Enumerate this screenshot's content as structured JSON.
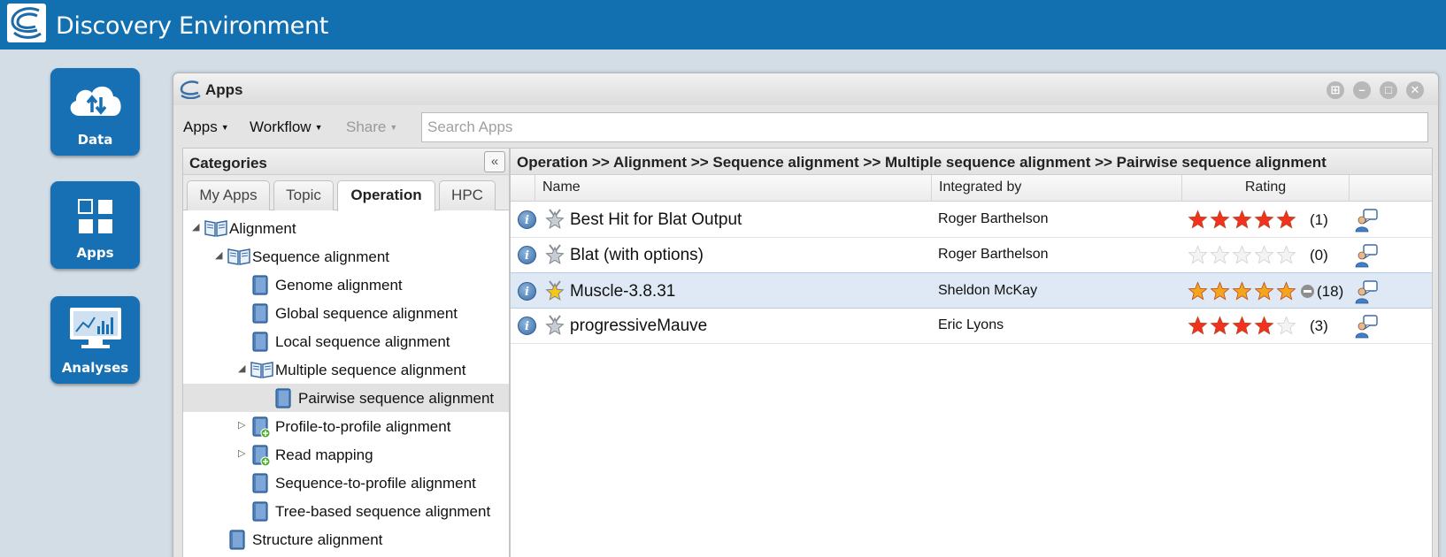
{
  "header": {
    "title": "Discovery Environment"
  },
  "dock": [
    {
      "label": "Data",
      "icon": "cloud-upload-download-icon"
    },
    {
      "label": "Apps",
      "icon": "apps-grid-icon"
    },
    {
      "label": "Analyses",
      "icon": "monitor-chart-icon"
    }
  ],
  "window": {
    "title": "Apps",
    "controls": [
      "layout-icon",
      "minimize-icon",
      "maximize-icon",
      "close-icon"
    ]
  },
  "toolbar": {
    "apps_menu": "Apps",
    "workflow_menu": "Workflow",
    "share_menu": "Share",
    "search_placeholder": "Search Apps"
  },
  "categories": {
    "title": "Categories",
    "tabs": [
      {
        "label": "My Apps",
        "active": false
      },
      {
        "label": "Topic",
        "active": false
      },
      {
        "label": "Operation",
        "active": true
      },
      {
        "label": "HPC",
        "active": false
      }
    ],
    "tree": [
      {
        "label": "Alignment",
        "state": "expanded",
        "type": "open-book",
        "level": 0
      },
      {
        "label": "Sequence alignment",
        "state": "expanded",
        "type": "open-book",
        "level": 1
      },
      {
        "label": "Genome alignment",
        "state": "leaf",
        "type": "book",
        "level": 2
      },
      {
        "label": "Global sequence alignment",
        "state": "leaf",
        "type": "book",
        "level": 2
      },
      {
        "label": "Local sequence alignment",
        "state": "leaf",
        "type": "book",
        "level": 2
      },
      {
        "label": "Multiple sequence alignment",
        "state": "expanded",
        "type": "open-book",
        "level": 2
      },
      {
        "label": "Pairwise sequence alignment",
        "state": "selected",
        "type": "book",
        "level": 3
      },
      {
        "label": "Profile-to-profile alignment",
        "state": "collapsed",
        "type": "book-plus",
        "level": 2
      },
      {
        "label": "Read mapping",
        "state": "collapsed",
        "type": "book-plus",
        "level": 2
      },
      {
        "label": "Sequence-to-profile alignment",
        "state": "leaf",
        "type": "book",
        "level": 2
      },
      {
        "label": "Tree-based sequence alignment",
        "state": "leaf",
        "type": "book",
        "level": 2
      },
      {
        "label": "Structure alignment",
        "state": "leaf",
        "type": "book",
        "level": 1
      }
    ]
  },
  "grid": {
    "breadcrumb": "Operation >> Alignment >> Sequence alignment >> Multiple sequence alignment >> Pairwise sequence alignment",
    "columns": {
      "name": "Name",
      "integrated_by": "Integrated by",
      "rating": "Rating"
    },
    "rows": [
      {
        "name": "Best Hit for Blat Output",
        "integrated_by": "Roger Barthelson",
        "rating": 5,
        "count": "(1)",
        "favorite": false,
        "star_color": "#f0321e"
      },
      {
        "name": "Blat (with options)",
        "integrated_by": "Roger Barthelson",
        "rating": 0,
        "count": "(0)",
        "favorite": false,
        "star_color": "#f0321e"
      },
      {
        "name": "Muscle-3.8.31",
        "integrated_by": "Sheldon McKay",
        "rating": 5,
        "count": "(18)",
        "favorite": true,
        "star_color": "#f4a51c"
      },
      {
        "name": "progressiveMauve",
        "integrated_by": "Eric Lyons",
        "rating": 4,
        "count": "(3)",
        "favorite": false,
        "star_color": "#f0321e"
      }
    ]
  }
}
